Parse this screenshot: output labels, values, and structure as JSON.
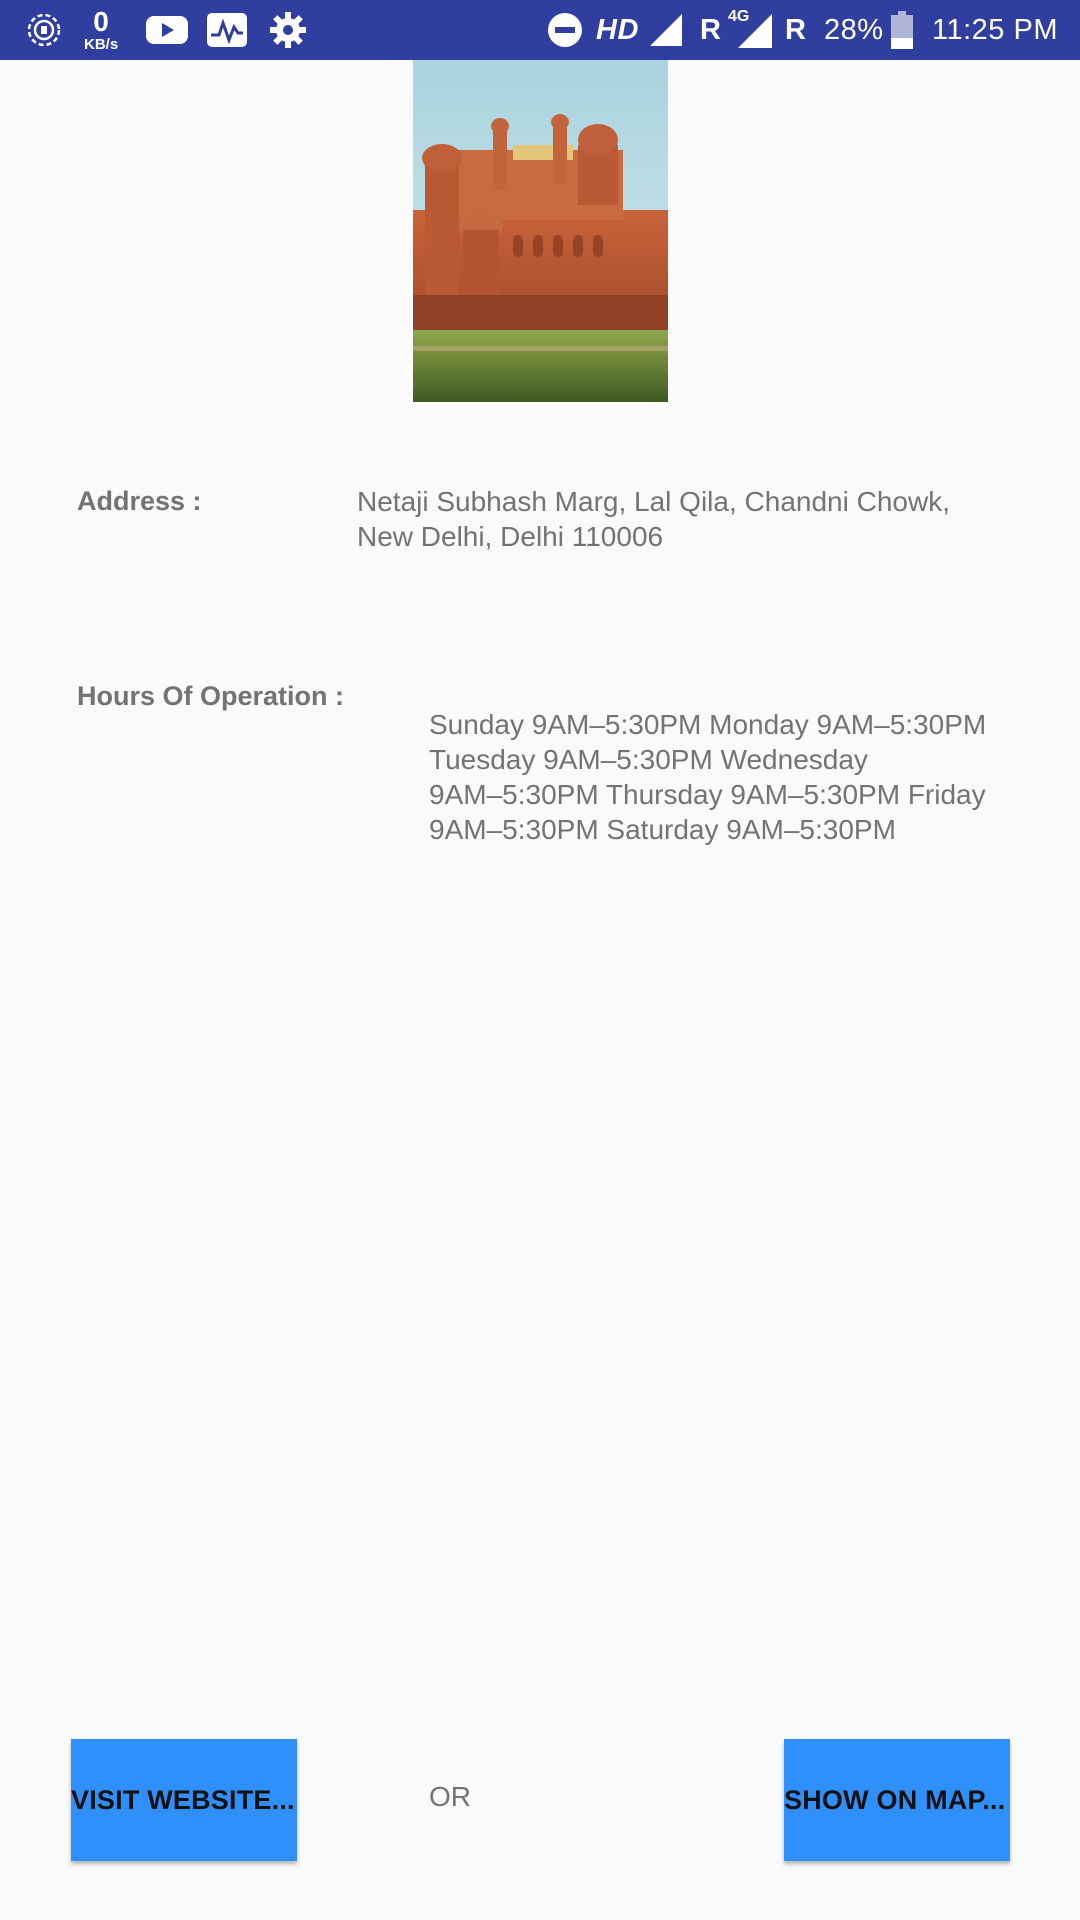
{
  "status_bar": {
    "speed_value": "0",
    "speed_unit": "KB/s",
    "network_hd": "HD",
    "roaming_1": "R",
    "network_4g": "4G",
    "roaming_2": "R",
    "battery": "28%",
    "time": "11:25 PM",
    "icons": [
      "data-saver-icon",
      "youtube-icon",
      "activity-icon",
      "settings-icon",
      "do-not-disturb-icon",
      "signal-icon",
      "signal-4g-icon",
      "battery-icon"
    ]
  },
  "place": {
    "address_label": "Address :",
    "address_line1": "Netaji Subhash Marg, Lal Qila, Chandni Chowk,",
    "address_line2": "New Delhi, Delhi 110006",
    "hours_label": "Hours Of Operation :",
    "hours_lines": [
      "Sunday 9AM–5:30PM Monday 9AM–5:30PM",
      "Tuesday 9AM–5:30PM Wednesday",
      "9AM–5:30PM Thursday 9AM–5:30PM Friday",
      "9AM–5:30PM Saturday 9AM–5:30PM"
    ]
  },
  "actions": {
    "visit_website_label": "VISIT WEBSITE...",
    "or_label": "OR",
    "show_on_map_label": "SHOW ON MAP..."
  },
  "colors": {
    "status_bar": "#303f9f",
    "button": "#2f8ffb",
    "text_gray": "#737373",
    "background": "#fafafa"
  }
}
